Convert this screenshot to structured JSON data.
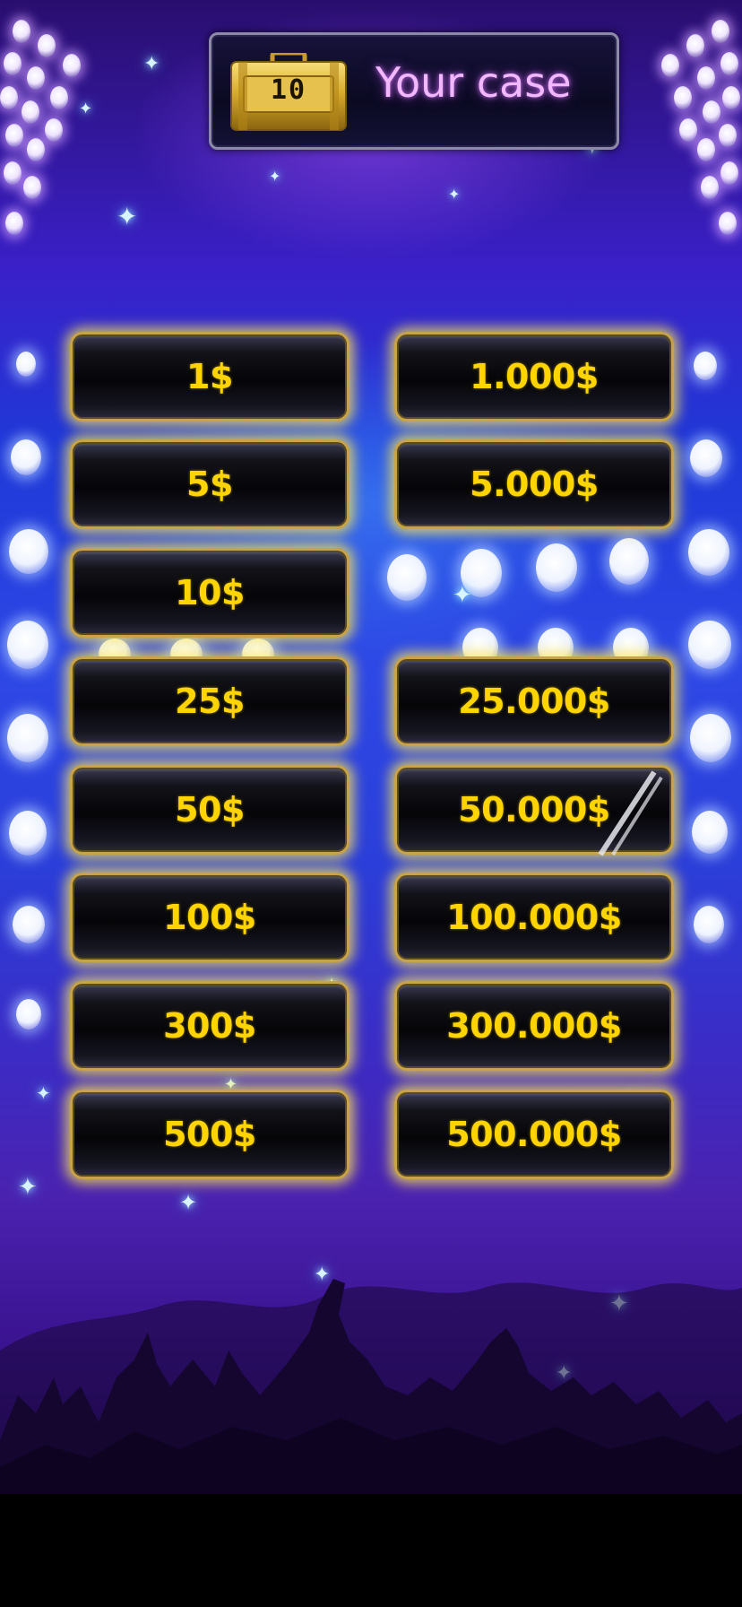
{
  "header": {
    "case_number": "10",
    "title": "Your case"
  },
  "prize_board": {
    "left_column": [
      {
        "value": "1$"
      },
      {
        "value": "5$"
      },
      {
        "value": "10$"
      },
      {
        "value": "25$"
      },
      {
        "value": "50$"
      },
      {
        "value": "100$"
      },
      {
        "value": "300$"
      },
      {
        "value": "500$"
      }
    ],
    "right_column": [
      {
        "value": "1.000$"
      },
      {
        "value": "5.000$"
      },
      {
        "value": ""
      },
      {
        "value": "25.000$"
      },
      {
        "value": "50.000$"
      },
      {
        "value": "100.000$"
      },
      {
        "value": "300.000$"
      },
      {
        "value": "500.000$"
      }
    ]
  },
  "colors": {
    "prize_text": "#ffd400",
    "title_text": "#f2b8ff",
    "plate_border": "#c9a34a",
    "plate_glow": "#ffeb50"
  },
  "icons": {
    "case": "briefcase-icon",
    "stage_lights": "spotlight-icon",
    "sparkles": "sparkle-icon",
    "crowd": "crowd-silhouette"
  }
}
